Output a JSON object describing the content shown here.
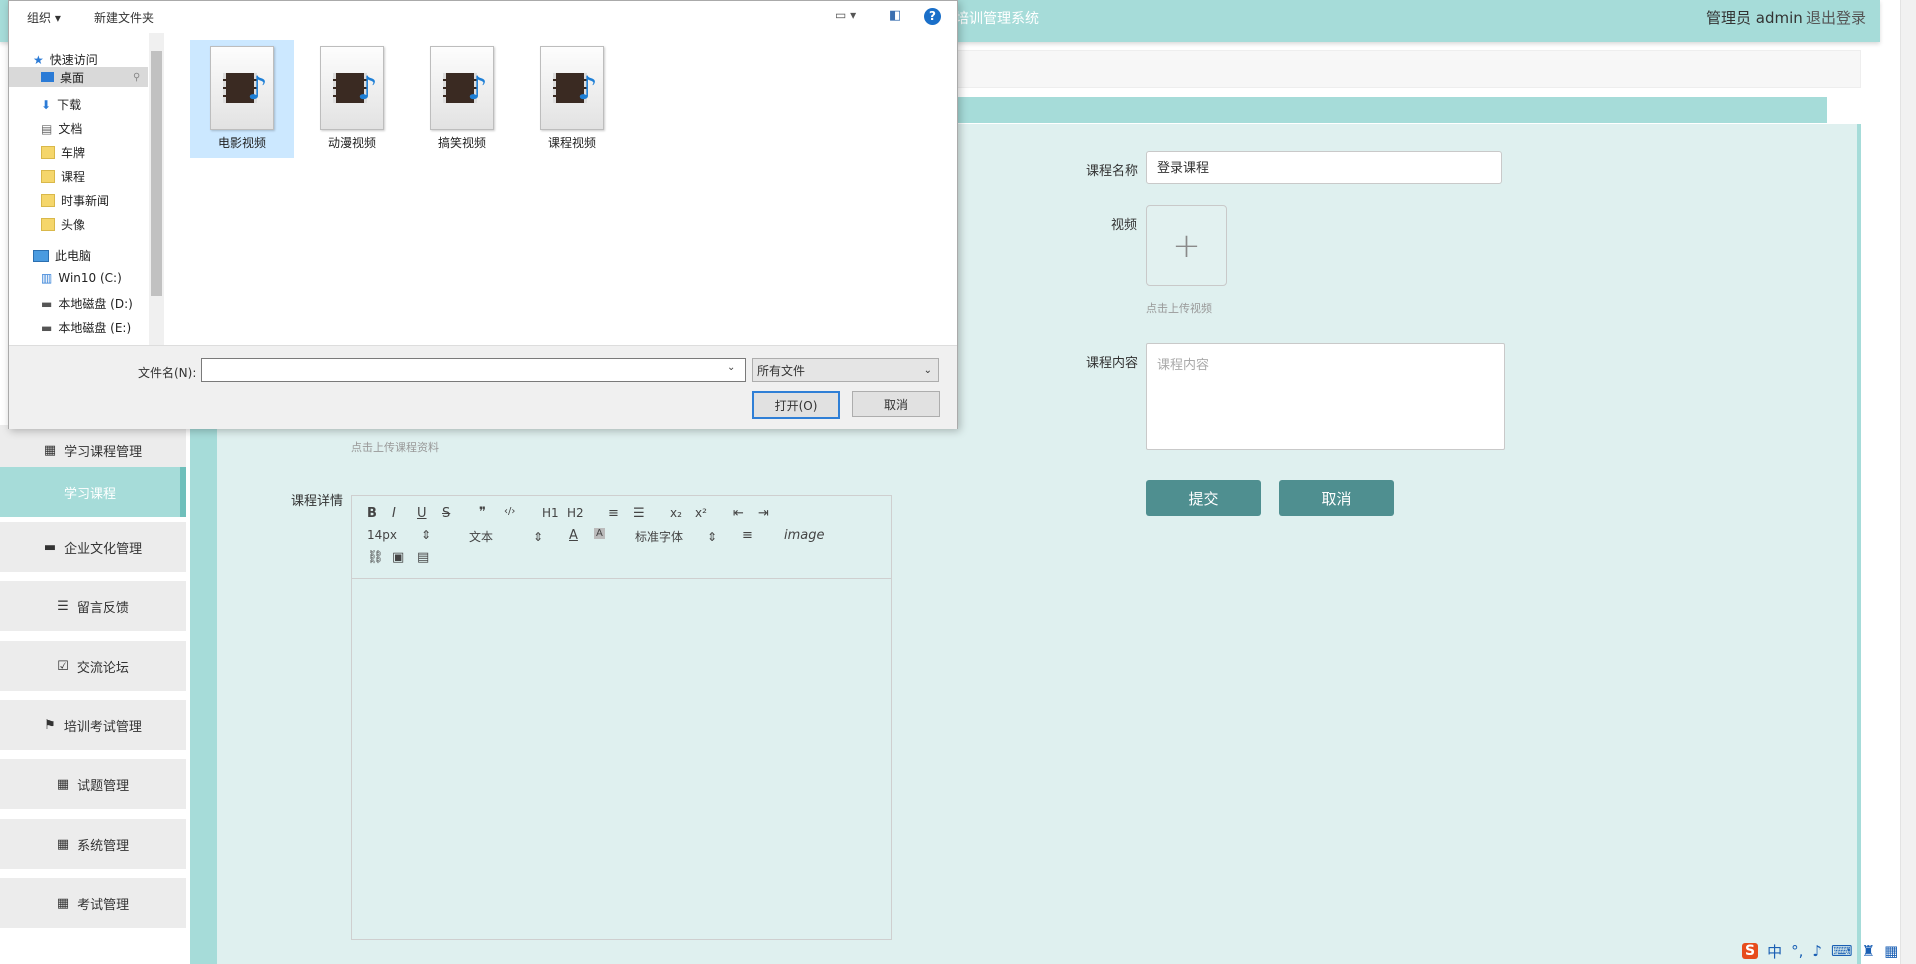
{
  "header": {
    "title": "培训管理系统",
    "user_label": "管理员 admin",
    "logout_label": "退出登录"
  },
  "sidebar": {
    "items": [
      {
        "label": "学习课程管理",
        "icon": "grid-icon"
      },
      {
        "label": "学习课程",
        "icon": ""
      },
      {
        "label": "企业文化管理",
        "icon": "monitor-icon"
      },
      {
        "label": "留言反馈",
        "icon": "list-icon"
      },
      {
        "label": "交流论坛",
        "icon": "clipboard-icon"
      },
      {
        "label": "培训考试管理",
        "icon": "flag-icon"
      },
      {
        "label": "试题管理",
        "icon": "grid-icon"
      },
      {
        "label": "系统管理",
        "icon": "grid-icon"
      },
      {
        "label": "考试管理",
        "icon": "grid-icon"
      }
    ]
  },
  "form": {
    "course_name_label": "课程名称",
    "course_name_value": "登录课程",
    "video_label": "视频",
    "video_hint": "点击上传视频",
    "content_label": "课程内容",
    "content_placeholder": "课程内容",
    "material_hint": "点击上传课程资料",
    "detail_label": "课程详情",
    "submit_label": "提交",
    "cancel_label": "取消"
  },
  "editor": {
    "font_size": "14px",
    "text_style": "文本",
    "font_family": "标准字体",
    "buttons": [
      "B",
      "I",
      "U",
      "S",
      "❞",
      "‹/›",
      "H1",
      "H2",
      "ol",
      "ul",
      "x₂",
      "x²",
      "outdent",
      "indent",
      "A",
      "A",
      "align",
      "Tx",
      "link",
      "image",
      "video"
    ]
  },
  "dialog": {
    "organize_label": "组织",
    "new_folder_label": "新建文件夹",
    "nav_items": [
      {
        "label": "快速访问",
        "icon": "star-icon",
        "pinned": false
      },
      {
        "label": "桌面",
        "icon": "desktop-icon",
        "pinned": true
      },
      {
        "label": "下载",
        "icon": "download-icon",
        "pinned": true
      },
      {
        "label": "文档",
        "icon": "document-icon",
        "pinned": true
      },
      {
        "label": "车牌",
        "icon": "folder-icon",
        "pinned": false
      },
      {
        "label": "课程",
        "icon": "folder-icon",
        "pinned": false
      },
      {
        "label": "时事新闻",
        "icon": "folder-icon",
        "pinned": false
      },
      {
        "label": "头像",
        "icon": "folder-icon",
        "pinned": false
      },
      {
        "label": "此电脑",
        "icon": "computer-icon",
        "pinned": false
      },
      {
        "label": "Win10 (C:)",
        "icon": "drive-icon",
        "pinned": false
      },
      {
        "label": "本地磁盘 (D:)",
        "icon": "drive-icon",
        "pinned": false
      },
      {
        "label": "本地磁盘 (E:)",
        "icon": "drive-icon",
        "pinned": false
      }
    ],
    "files": [
      "电影视频",
      "动漫视频",
      "搞笑视频",
      "课程视频"
    ],
    "filename_label": "文件名(N):",
    "filename_value": "",
    "filetype_value": "所有文件",
    "open_label": "打开(O)",
    "cancel_label": "取消"
  },
  "ime": {
    "lang": "中"
  }
}
